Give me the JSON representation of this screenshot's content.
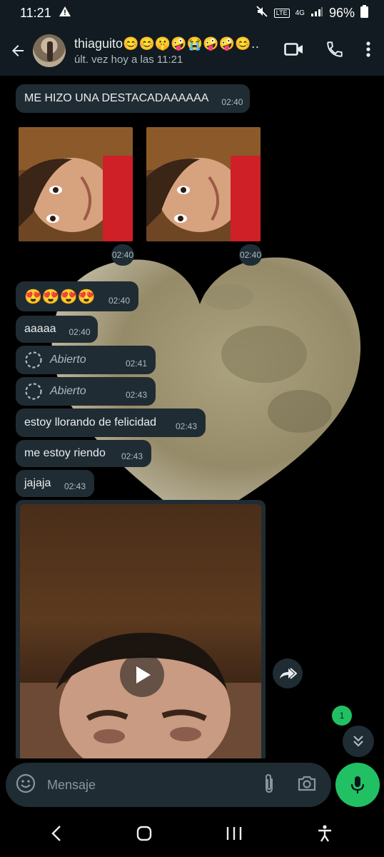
{
  "status_bar": {
    "time": "11:21",
    "battery": "96%",
    "network": "4G"
  },
  "header": {
    "contact_name": "thiaguito😊😊🤫🤪😭🤪🤪😊…",
    "contact_status": "últ. vez hoy a las 11:21"
  },
  "messages": [
    {
      "text": "ME HIZO UNA DESTACADAAAAAA",
      "time": "02:40"
    },
    {
      "text": "😍😍😍😍",
      "time": "02:40"
    },
    {
      "text": "aaaaa",
      "time": "02:40"
    },
    {
      "text": "Abierto",
      "time": "02:41"
    },
    {
      "text": "Abierto",
      "time": "02:43"
    },
    {
      "text": "estoy llorando de felicidad",
      "time": "02:43"
    },
    {
      "text": "me estoy riendo",
      "time": "02:43"
    },
    {
      "text": "jajaja",
      "time": "02:43"
    }
  ],
  "photos": [
    {
      "time": "02:40"
    },
    {
      "time": "02:40"
    }
  ],
  "unread_count": "1",
  "input": {
    "placeholder": "Mensaje"
  },
  "colors": {
    "accent": "#21c063",
    "bubble": "#202c33",
    "header": "#111b21"
  }
}
